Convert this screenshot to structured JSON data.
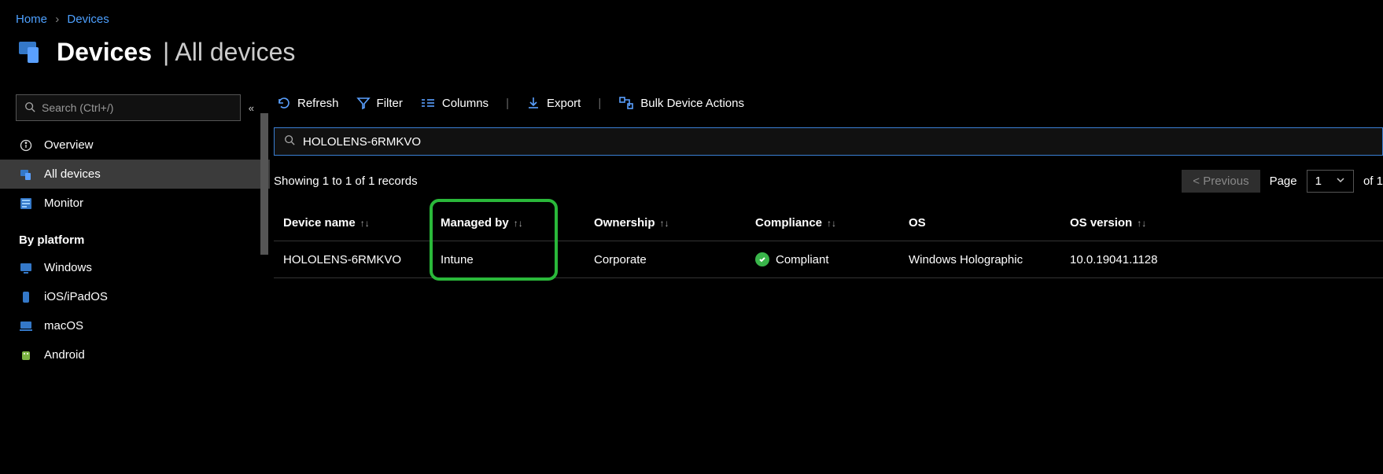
{
  "breadcrumb": {
    "home": "Home",
    "devices": "Devices"
  },
  "header": {
    "title": "Devices",
    "subtitle": "All devices"
  },
  "sidebar": {
    "search_placeholder": "Search (Ctrl+/)",
    "items": {
      "overview": "Overview",
      "all_devices": "All devices",
      "monitor": "Monitor"
    },
    "section_platform": "By platform",
    "platforms": {
      "windows": "Windows",
      "ios": "iOS/iPadOS",
      "macos": "macOS",
      "android": "Android"
    }
  },
  "toolbar": {
    "refresh": "Refresh",
    "filter": "Filter",
    "columns": "Columns",
    "export": "Export",
    "bulk": "Bulk Device Actions"
  },
  "search": {
    "value": "HOLOLENS-6RMKVO"
  },
  "records": {
    "text": "Showing 1 to 1 of 1 records"
  },
  "pager": {
    "previous": "< Previous",
    "page_label": "Page",
    "page_value": "1",
    "of_label": "of 1"
  },
  "table": {
    "headers": {
      "device_name": "Device name",
      "managed_by": "Managed by",
      "ownership": "Ownership",
      "compliance": "Compliance",
      "os": "OS",
      "os_version": "OS version"
    },
    "rows": [
      {
        "device_name": "HOLOLENS-6RMKVO",
        "managed_by": "Intune",
        "ownership": "Corporate",
        "compliance": "Compliant",
        "os": "Windows Holographic",
        "os_version": "10.0.19041.1128"
      }
    ]
  }
}
